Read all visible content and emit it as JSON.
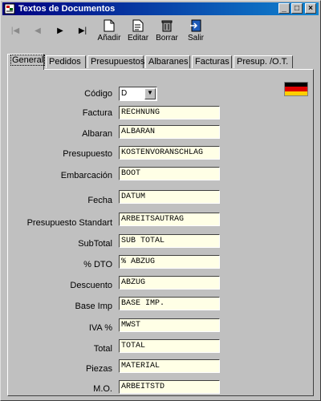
{
  "window": {
    "title": "Textos de Documentos",
    "controls": [
      "_",
      "□",
      "×"
    ]
  },
  "toolbar": {
    "nav": [
      "|◀",
      "◀",
      "▶",
      "▶|"
    ],
    "buttons": [
      {
        "label": "Añadir",
        "icon": "add-document-icon"
      },
      {
        "label": "Editar",
        "icon": "edit-document-icon"
      },
      {
        "label": "Borrar",
        "icon": "trash-icon"
      },
      {
        "label": "Salir",
        "icon": "exit-icon"
      }
    ]
  },
  "tabs": [
    {
      "label": "General",
      "active": true
    },
    {
      "label": "Pedidos"
    },
    {
      "label": "Presupuestos"
    },
    {
      "label": "Albaranes"
    },
    {
      "label": "Facturas"
    },
    {
      "label": "Presup. /O.T."
    }
  ],
  "flag": {
    "icon": "german-flag-icon",
    "colors": [
      "#000000",
      "#dd0000",
      "#ffce00"
    ]
  },
  "codigo": {
    "label": "Código",
    "value": "D"
  },
  "fields": [
    {
      "label": "Factura",
      "value": "RECHNUNG"
    },
    {
      "label": "Albaran",
      "value": "ALBARAN"
    },
    {
      "label": "Presupuesto",
      "value": "KOSTENVORANSCHLAG"
    },
    {
      "label": "Embarcación",
      "value": "BOOT"
    },
    {
      "label": "Fecha",
      "value": "DATUM"
    },
    {
      "label": "Presupuesto Standart",
      "value": "ARBEITSAUTRAG"
    },
    {
      "label": "SubTotal",
      "value": "SUB TOTAL"
    },
    {
      "label": "% DTO",
      "value": "% ABZUG"
    },
    {
      "label": "Descuento",
      "value": "ABZUG"
    },
    {
      "label": "Base Imp",
      "value": "BASE IMP."
    },
    {
      "label": "IVA %",
      "value": "MWST"
    },
    {
      "label": "Total",
      "value": "TOTAL"
    },
    {
      "label": "Piezas",
      "value": "MATERIAL"
    },
    {
      "label": "M.O.",
      "value": "ARBEITSTD"
    }
  ],
  "colors": {
    "titlebar": "#000080",
    "field_bg": "#ffffe6",
    "window_bg": "#c0c0c0"
  }
}
